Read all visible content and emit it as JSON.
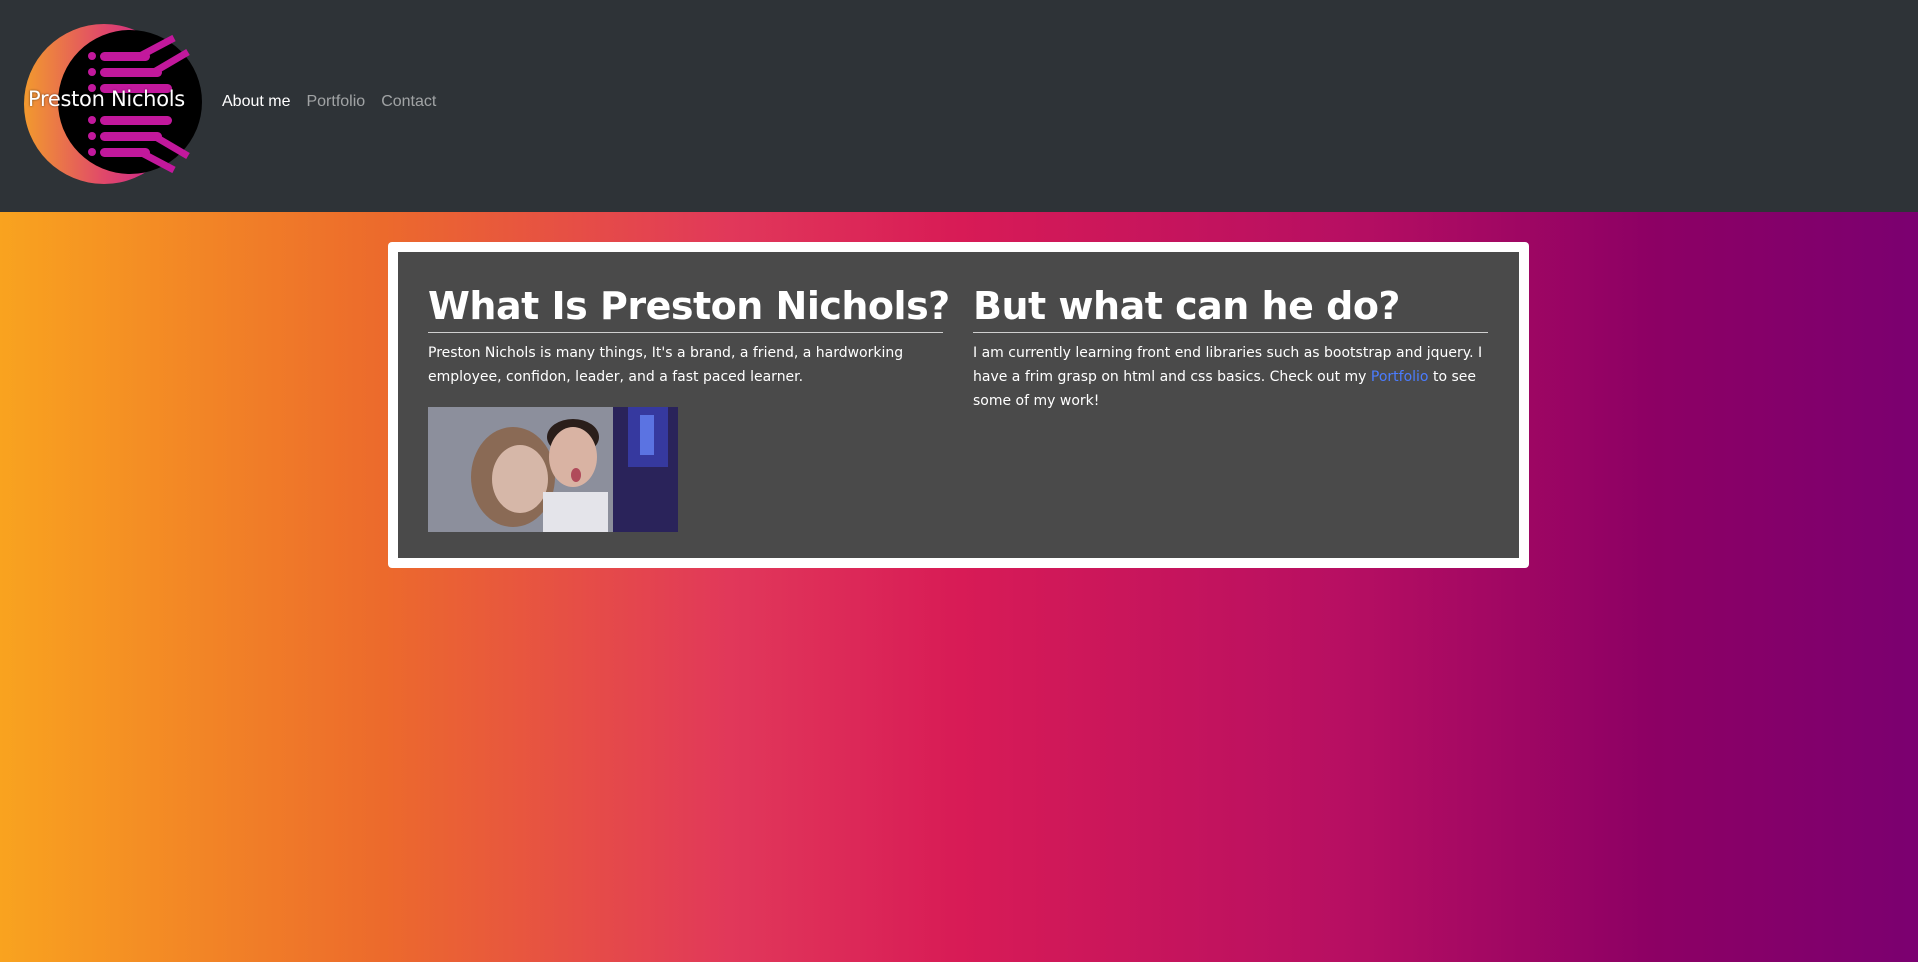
{
  "navbar": {
    "logo_text": "Preston Nichols",
    "links": [
      {
        "label": "About me",
        "active": true
      },
      {
        "label": "Portfolio",
        "active": false
      },
      {
        "label": "Contact",
        "active": false
      }
    ]
  },
  "main": {
    "left": {
      "heading": "What Is Preston Nichols?",
      "text": "Preston Nichols is many things, It's a brand, a friend, a hardworking employee, confidon, leader, and a fast paced learner."
    },
    "right": {
      "heading": "But what can he do?",
      "text_before": "I am currently learning front end libraries such as bootstrap and jquery. I have a frim grasp on html and css basics. Check out my ",
      "link": "Portfolio",
      "text_after": " to see some of my work!"
    }
  },
  "colors": {
    "navbar_bg": "#2e3337",
    "card_bg": "#4a4a4a",
    "link": "#4a7cff",
    "logo_magenta": "#c2189c"
  }
}
